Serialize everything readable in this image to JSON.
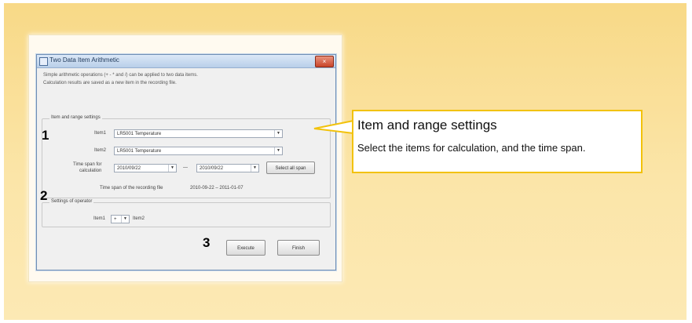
{
  "dialog": {
    "title": "Two Data Item Arithmetic",
    "close_glyph": "×",
    "desc_line1": "Simple arithmetic operations (+ - * and /) can be applied to two data items.",
    "desc_line2": "Calculation results are saved as a new item in the recording file.",
    "item_range": {
      "group_label": "Item and range settings",
      "item1_label": "Item1",
      "item1_value": "LR5001  Temperature",
      "item2_label": "Item2",
      "item2_value": "LR5001  Temperature",
      "timespan_label_1": "Time span for",
      "timespan_label_2": "calculation",
      "start_value": "2010/09/22",
      "range_sep": "—",
      "end_value": "2010/09/22",
      "select_all_label": "Select all span",
      "recording_span_label": "Time span of the recording file",
      "recording_span_value": "2010-09-22 – 2011-01-07"
    },
    "operator": {
      "group_label": "Settings of operator",
      "left_label": "Item1",
      "operator_value": "+",
      "right_label": "Item2"
    },
    "execute_label": "Execute",
    "finish_label": "Finish"
  },
  "steps": {
    "one": "1",
    "two": "2",
    "three": "3"
  },
  "callout": {
    "title": "Item and range settings",
    "body": "Select the items for calculation, and the time span."
  },
  "colors": {
    "background": "#f8d987",
    "callout_border": "#f2c20a",
    "dialog_border": "#6f8fb5"
  }
}
